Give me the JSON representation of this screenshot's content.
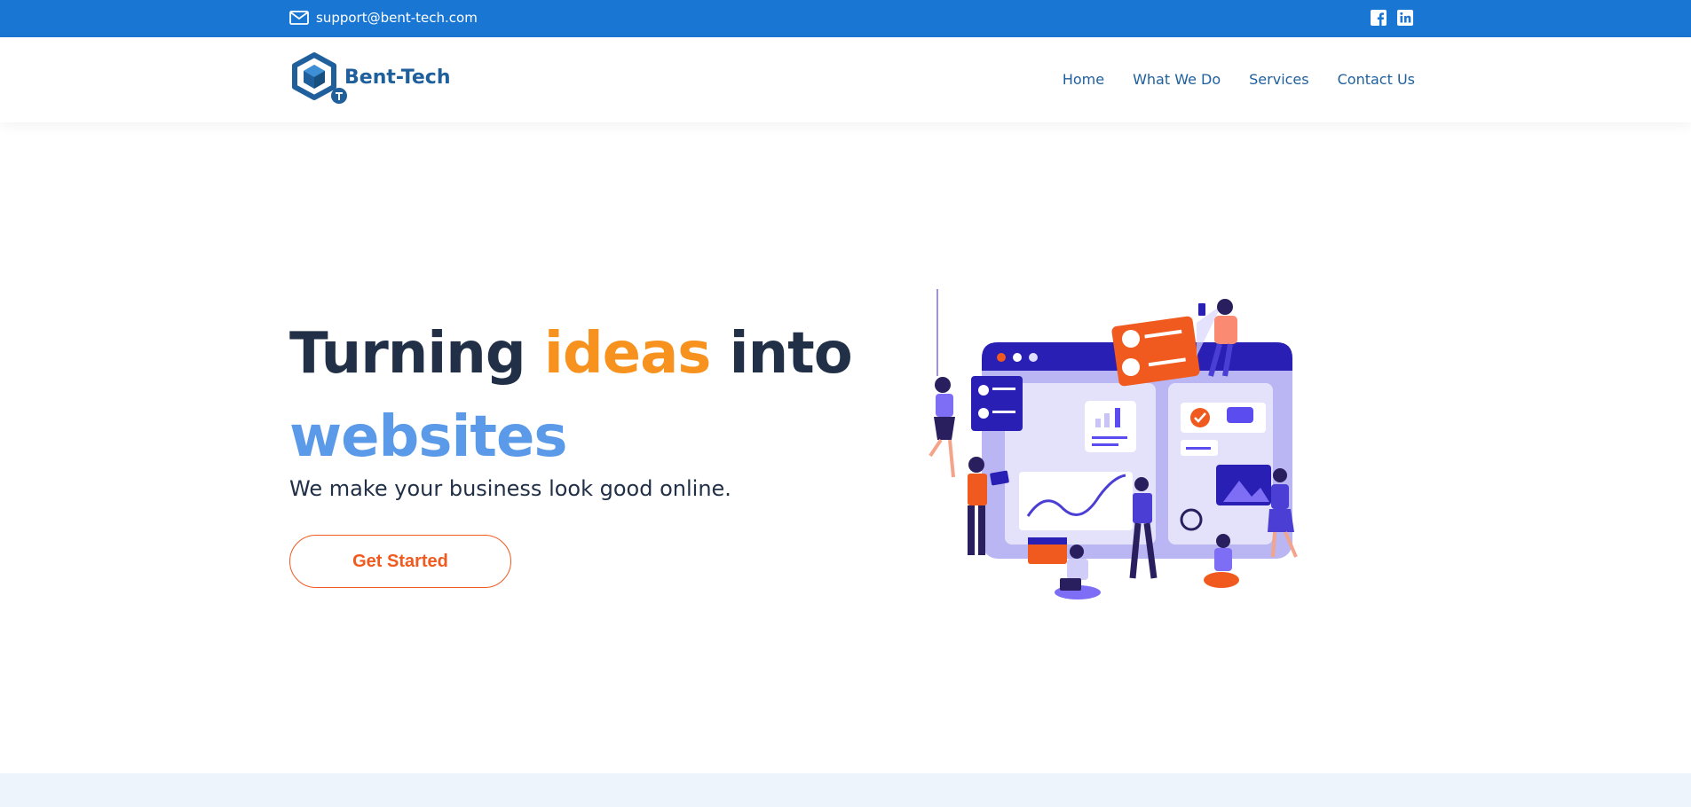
{
  "topbar": {
    "email": "support@bent-tech.com",
    "email_icon": "mail-icon",
    "socials": [
      {
        "icon": "facebook-icon"
      },
      {
        "icon": "linkedin-icon"
      }
    ],
    "background": "#1976d2"
  },
  "brand": {
    "name": "Bent-Tech",
    "logo_icon": "hexagon-logo-icon"
  },
  "nav": {
    "items": [
      "Home",
      "What We Do",
      "Services",
      "Contact Us"
    ]
  },
  "hero": {
    "title_part1": "Turning ",
    "title_accent": "ideas",
    "title_part2": " into",
    "title_line2": "websites",
    "subtitle": "We make your business look good online.",
    "cta_label": "Get Started",
    "colors": {
      "dark": "#213047",
      "accent_orange": "#f7921e",
      "accent_blue": "#5a9ae8",
      "cta": "#f05a1f"
    }
  },
  "illustration": {
    "icon": "team-web-dashboard-illustration"
  }
}
